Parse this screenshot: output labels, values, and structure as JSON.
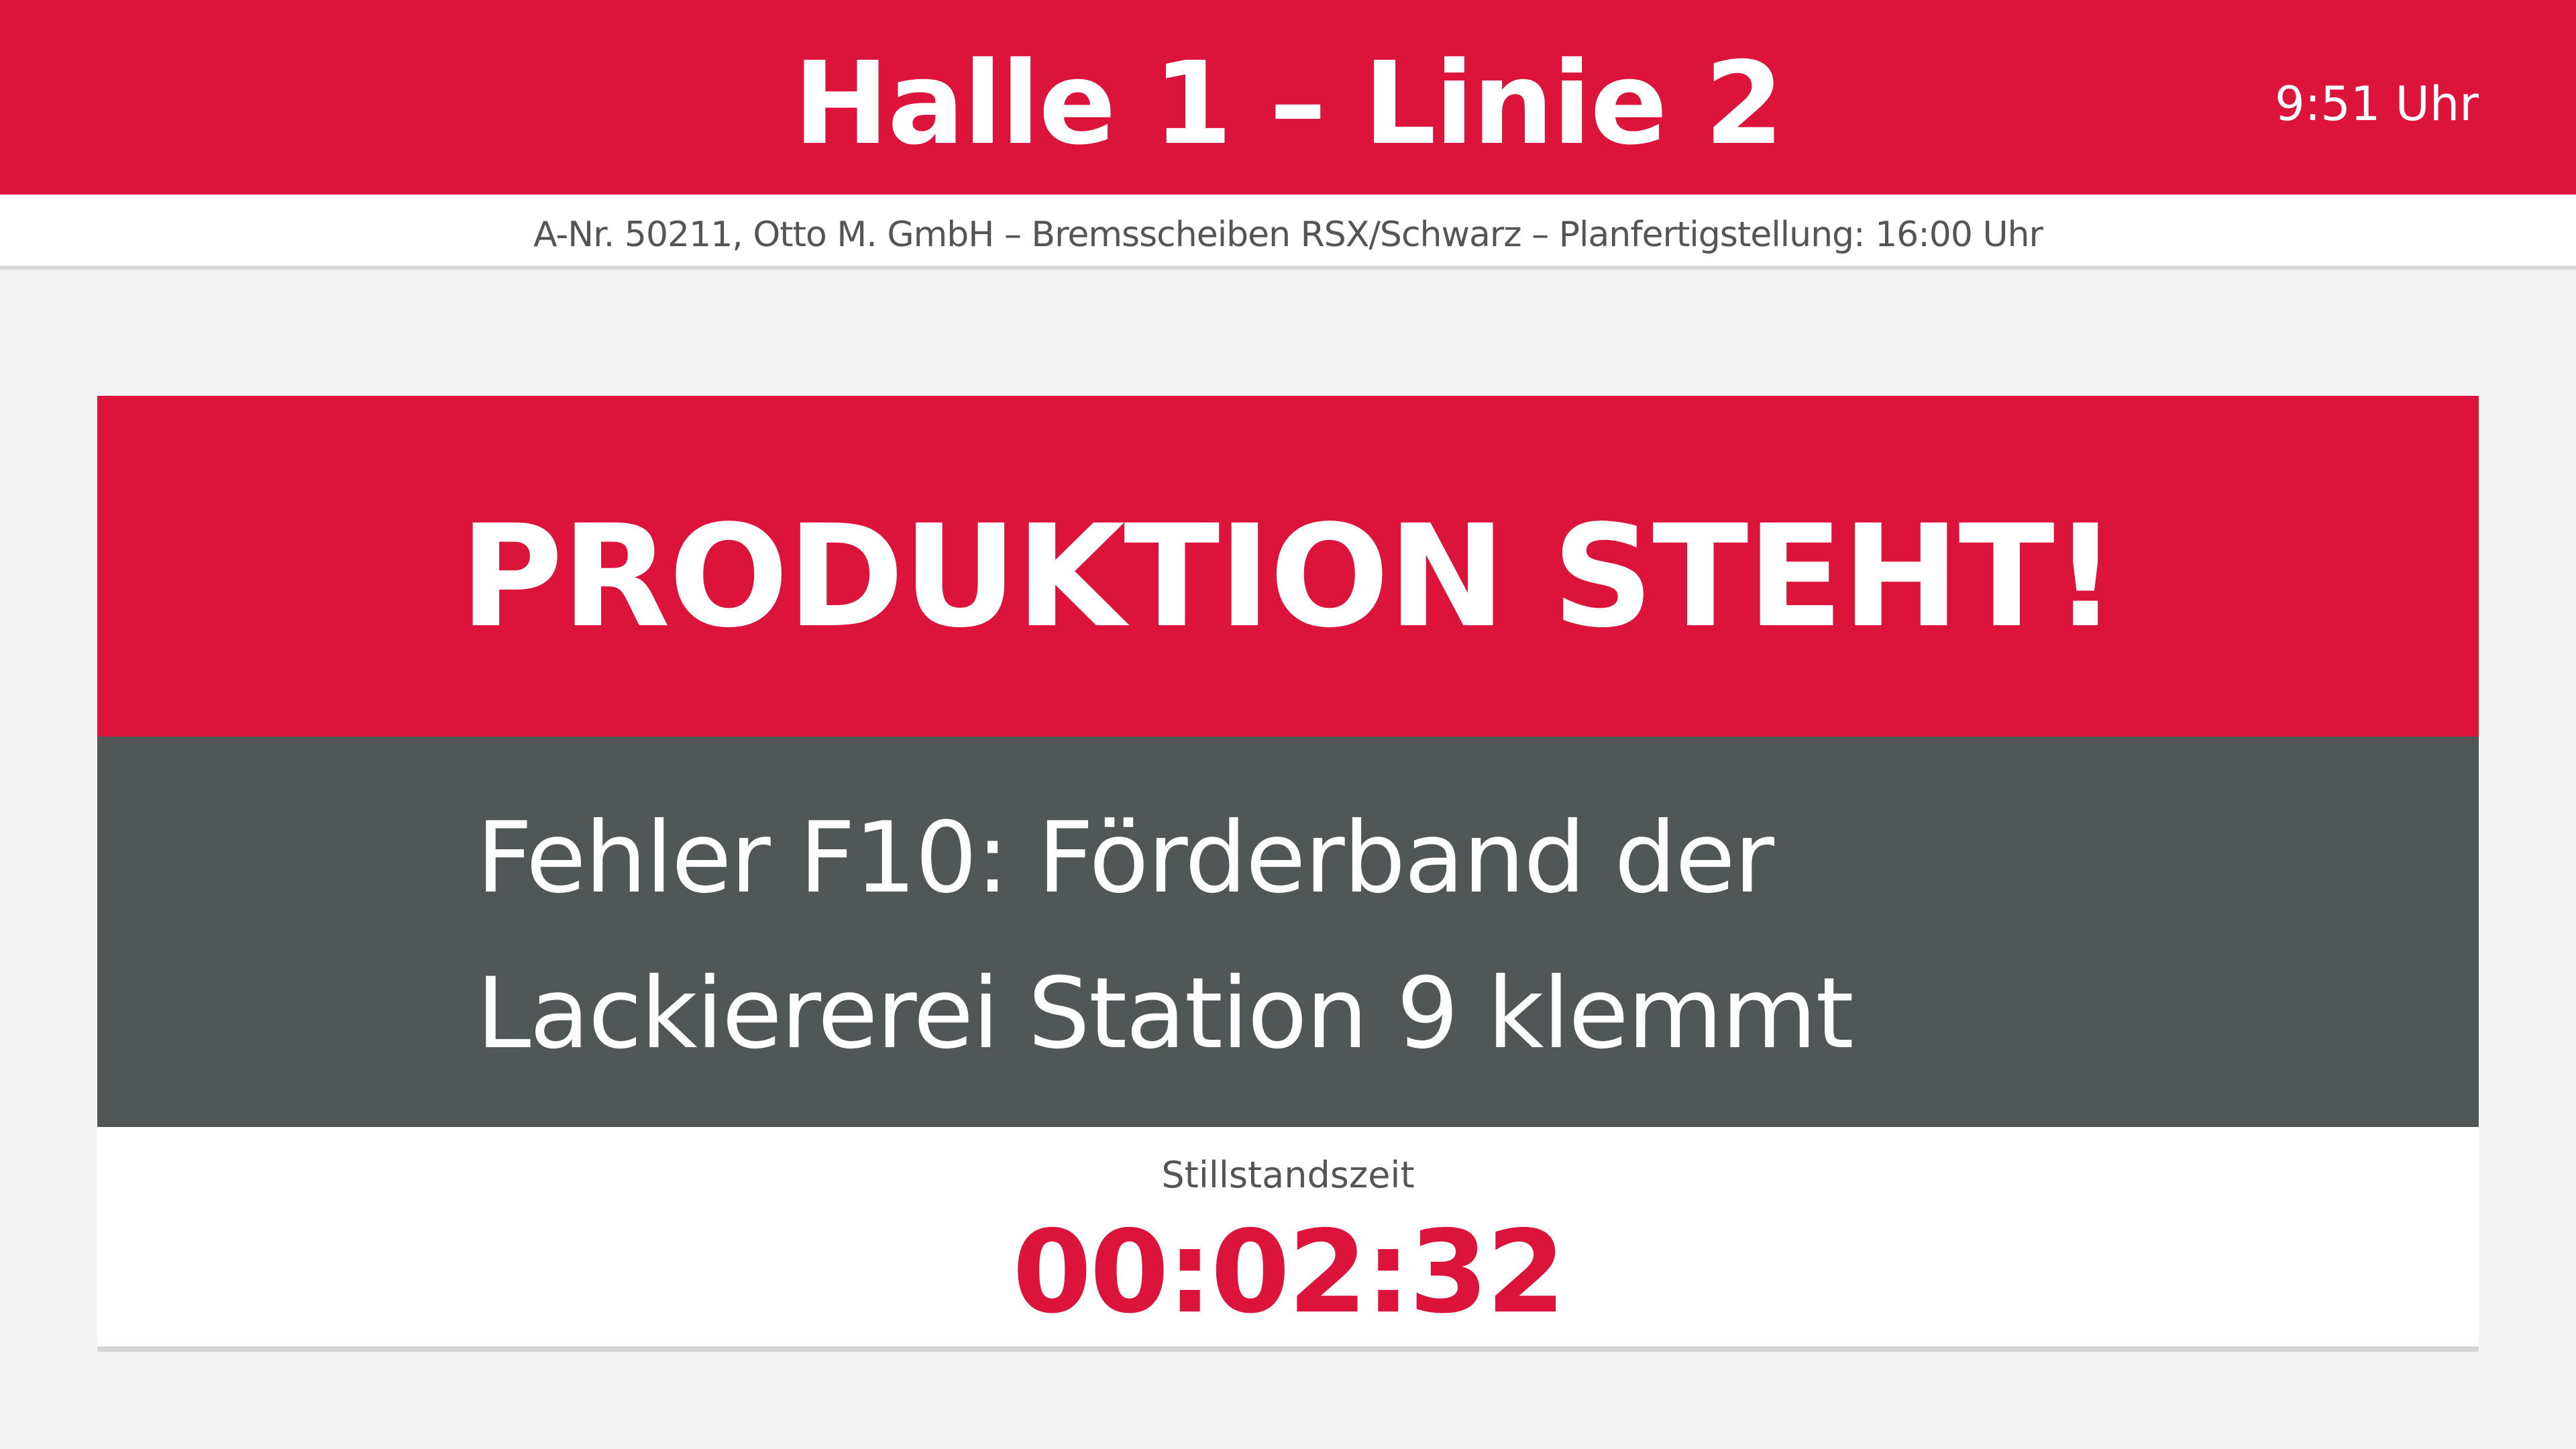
{
  "header": {
    "title": "Halle 1 – Linie 2",
    "clock": "9:51 Uhr"
  },
  "order_info": "A-Nr. 50211, Otto M. GmbH  –  Bremsscheiben RSX/Schwarz  –  Planfertigstellung: 16:00 Uhr",
  "alert": {
    "status": "PRODUKTION STEHT!",
    "error_lines": [
      "Fehler F10: Förderband der",
      "Lackiererei Station 9 klemmt"
    ],
    "downtime_label": "Stillstandszeit",
    "downtime_value": "00:02:32"
  },
  "colors": {
    "accent_red": "#dc143c",
    "error_panel": "#515757",
    "background": "#f3f3f3"
  }
}
